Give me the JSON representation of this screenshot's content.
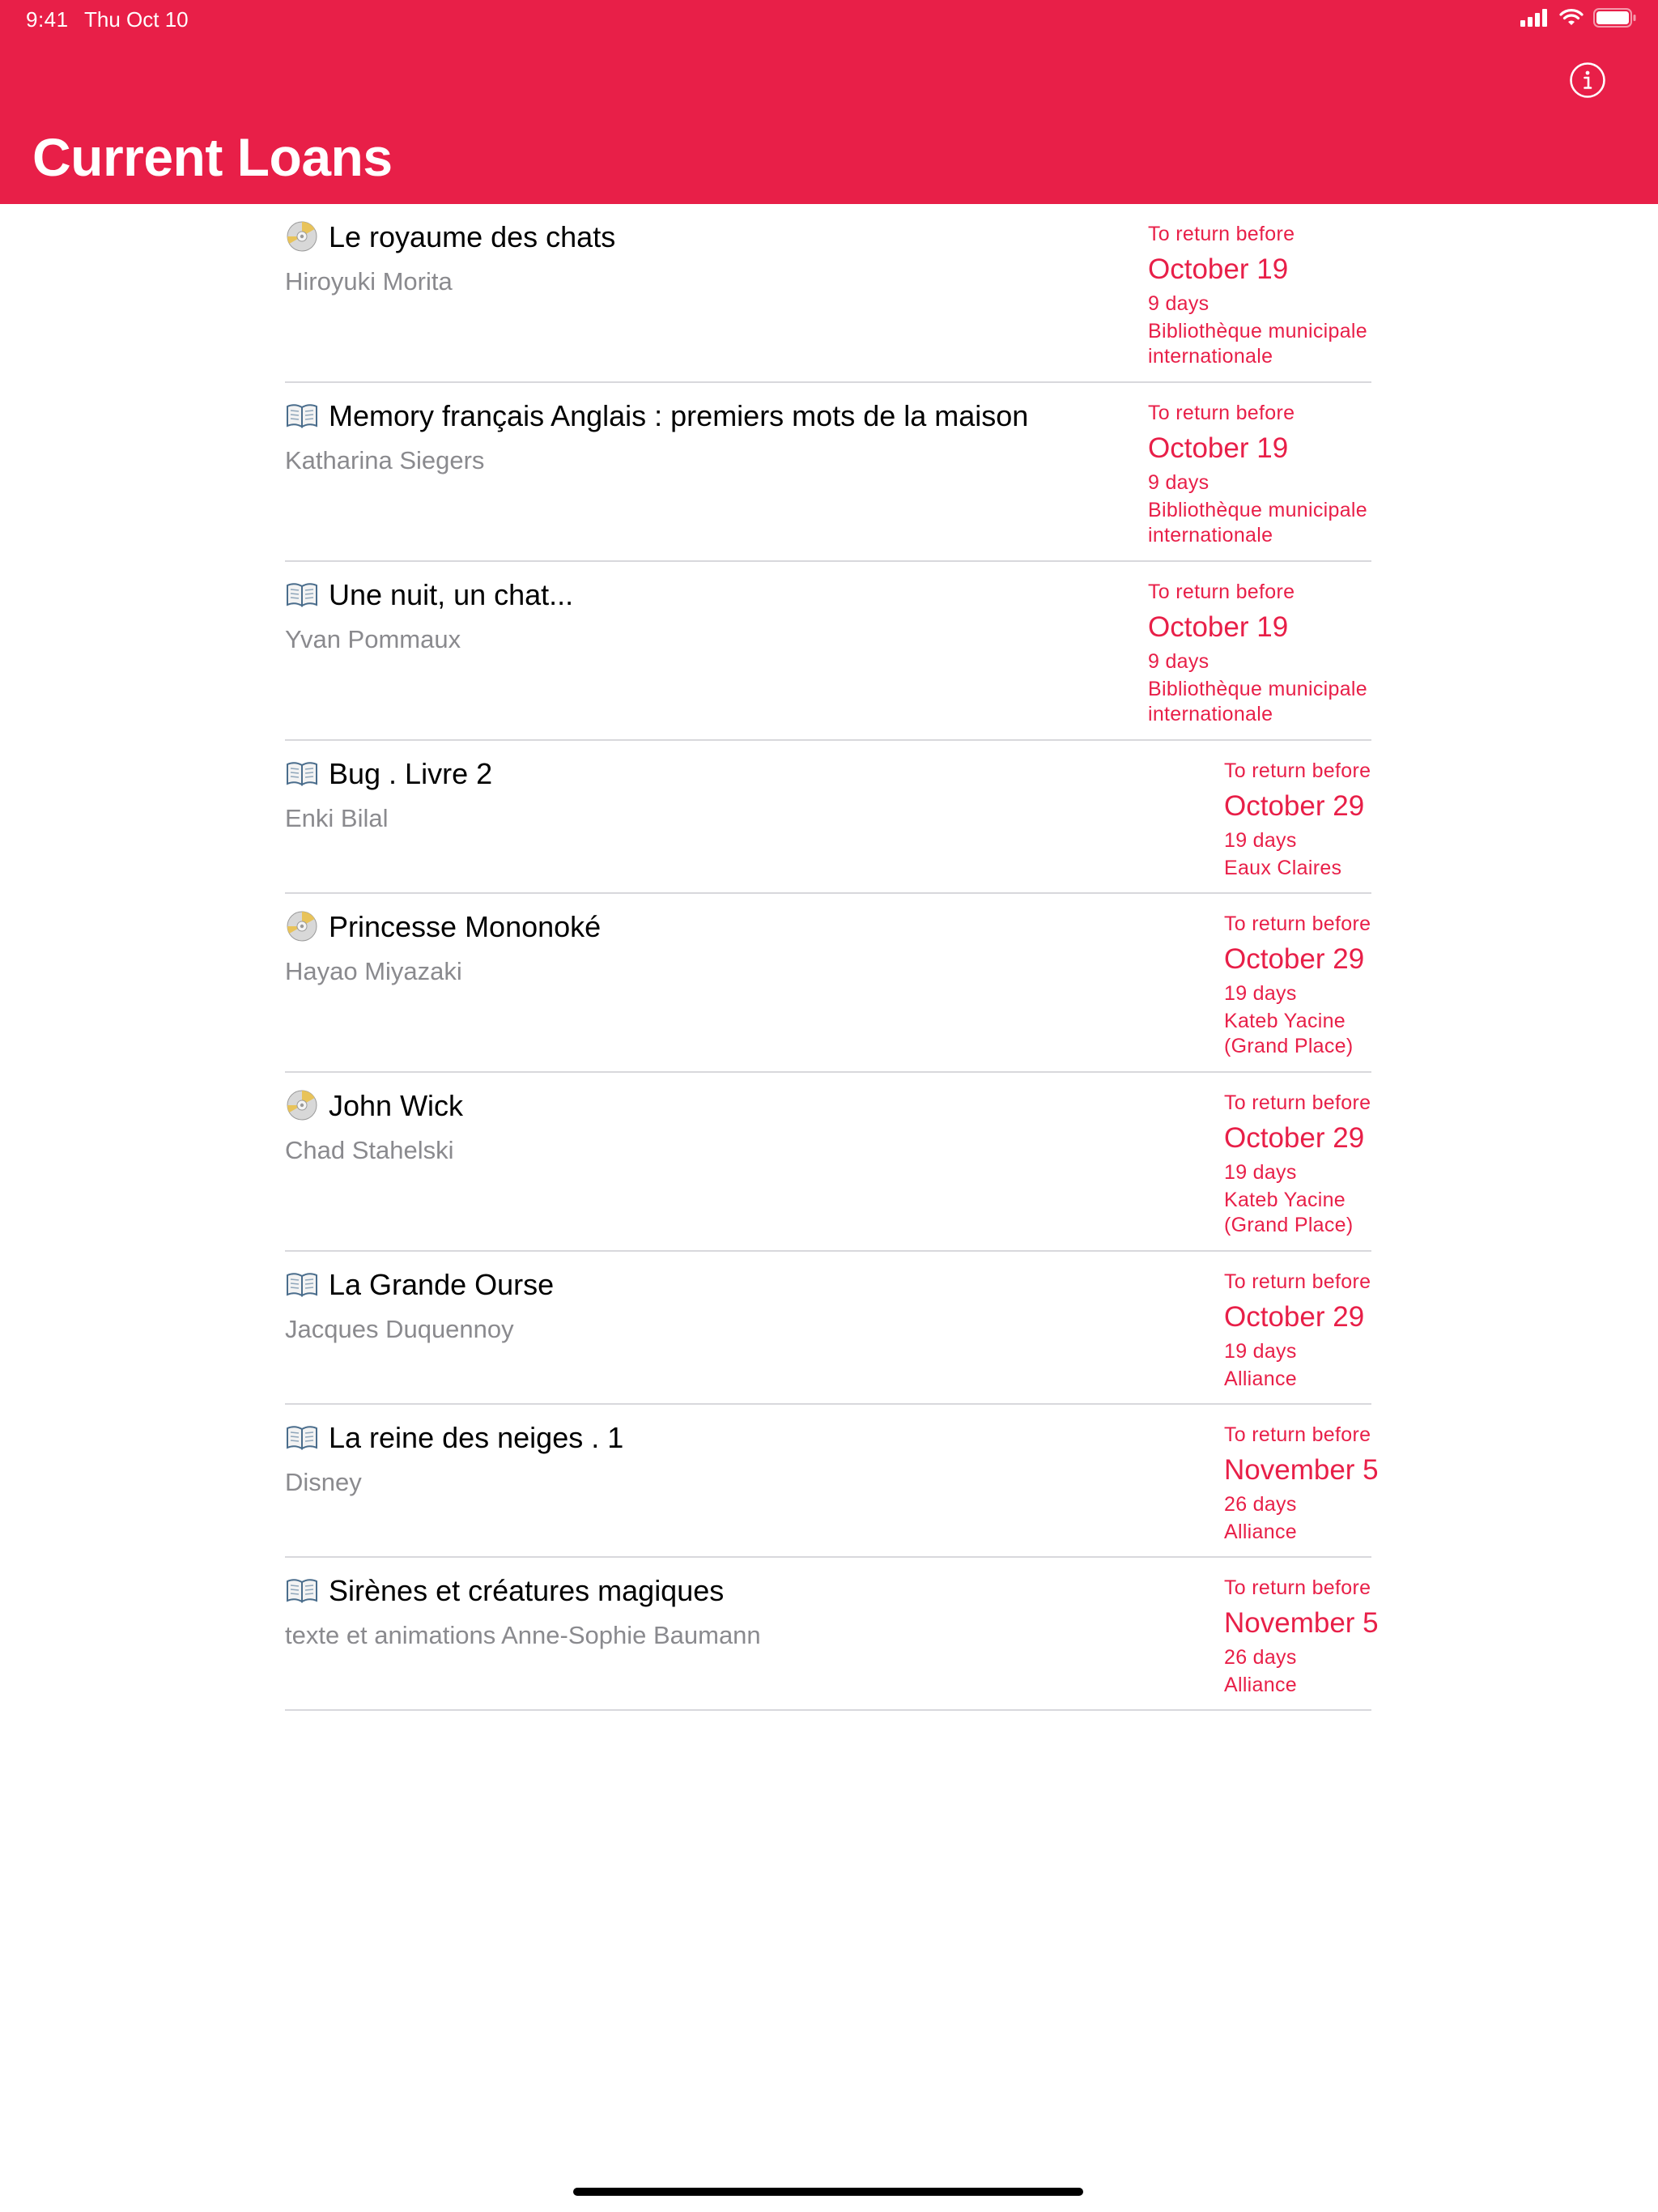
{
  "status_bar": {
    "time": "9:41",
    "date": "Thu Oct 10"
  },
  "header": {
    "title": "Current Loans",
    "background_color": "#E81F48",
    "info_icon": "info-circle-icon"
  },
  "colors": {
    "accent": "#E81F48",
    "secondary_text": "#8a8a8e",
    "separator": "#d8d8dc"
  },
  "loans": [
    {
      "media": "disc",
      "title": "Le royaume des chats",
      "author": "Hiroyuki Morita",
      "due_label": "To return before",
      "due_date": "October 19",
      "days_left": "9 days",
      "library_line1": "Bibliothèque municipale",
      "library_line2": "internationale"
    },
    {
      "media": "book",
      "title": "Memory français Anglais : premiers mots de la maison",
      "author": "Katharina Siegers",
      "due_label": "To return before",
      "due_date": "October 19",
      "days_left": "9 days",
      "library_line1": "Bibliothèque municipale",
      "library_line2": "internationale"
    },
    {
      "media": "book",
      "title": "Une nuit, un chat...",
      "author": "Yvan Pommaux",
      "due_label": "To return before",
      "due_date": "October 19",
      "days_left": "9 days",
      "library_line1": "Bibliothèque municipale",
      "library_line2": "internationale"
    },
    {
      "media": "book",
      "title": "Bug . Livre 2",
      "author": "Enki Bilal",
      "due_label": "To return before",
      "due_date": "October 29",
      "days_left": "19 days",
      "library_line1": "Eaux Claires",
      "library_line2": ""
    },
    {
      "media": "disc",
      "title": "Princesse Mononoké",
      "author": "Hayao Miyazaki",
      "due_label": "To return before",
      "due_date": "October 29",
      "days_left": "19 days",
      "library_line1": "Kateb Yacine",
      "library_line2": "(Grand Place)"
    },
    {
      "media": "disc",
      "title": "John Wick",
      "author": "Chad Stahelski",
      "due_label": "To return before",
      "due_date": "October 29",
      "days_left": "19 days",
      "library_line1": "Kateb Yacine",
      "library_line2": "(Grand Place)"
    },
    {
      "media": "book",
      "title": "La Grande Ourse",
      "author": "Jacques Duquennoy",
      "due_label": "To return before",
      "due_date": "October 29",
      "days_left": "19 days",
      "library_line1": "Alliance",
      "library_line2": ""
    },
    {
      "media": "book",
      "title": "La reine des neiges . 1",
      "author": "Disney",
      "due_label": "To return before",
      "due_date": "November 5",
      "days_left": "26 days",
      "library_line1": "Alliance",
      "library_line2": ""
    },
    {
      "media": "book",
      "title": "Sirènes et créatures magiques",
      "author": "texte et animations Anne-Sophie Baumann",
      "due_label": "To return before",
      "due_date": "November 5",
      "days_left": "26 days",
      "library_line1": "Alliance",
      "library_line2": ""
    }
  ]
}
